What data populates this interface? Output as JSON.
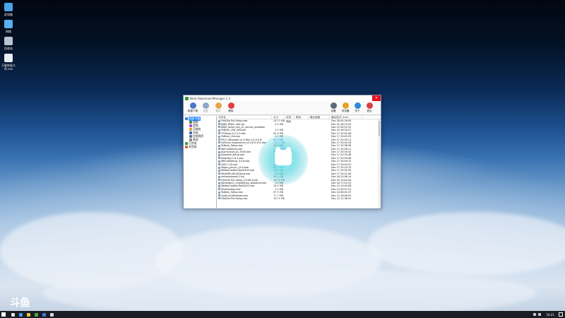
{
  "desktop": {
    "icons": [
      {
        "label": "此电脑",
        "color": "#4aa3e8"
      },
      {
        "label": "网络",
        "color": "#5ab0ee"
      },
      {
        "label": "回收站",
        "color": "#b8c4d0"
      },
      {
        "label": "万能恢复大师.exe",
        "color": "#e8eef4"
      }
    ],
    "logo_text": "斗鱼"
  },
  "window": {
    "title": "Neat Download Manager 1.3",
    "close_glyph": "✕",
    "toolbar": {
      "left": [
        {
          "label": "新建下载",
          "icon": "new-download-icon",
          "color": "#4a78c8",
          "disabled": false
        },
        {
          "label": "恢复",
          "icon": "resume-icon",
          "color": "#8fa7c8",
          "disabled": true
        },
        {
          "label": "暂停",
          "icon": "pause-icon",
          "color": "#e8a64a",
          "disabled": true
        },
        {
          "label": "删除",
          "icon": "delete-icon",
          "color": "#e04040",
          "disabled": false
        }
      ],
      "right": [
        {
          "label": "设置",
          "icon": "settings-icon",
          "color": "#5a6a7a"
        },
        {
          "label": "浏览器",
          "icon": "browser-icon",
          "color": "#e8a02a"
        },
        {
          "label": "关于",
          "icon": "about-icon",
          "color": "#2a8ad8"
        },
        {
          "label": "退出",
          "icon": "exit-icon",
          "color": "#d84040"
        }
      ]
    },
    "tree": [
      {
        "label": "所有下载",
        "indent": 0,
        "selected": true,
        "color": "#3a7ad0"
      },
      {
        "label": "视频",
        "indent": 2,
        "selected": false,
        "color": "#4a8a4a"
      },
      {
        "label": "音频",
        "indent": 2,
        "selected": false,
        "color": "#a84ad0"
      },
      {
        "label": "压缩包",
        "indent": 2,
        "selected": false,
        "color": "#d8a02a"
      },
      {
        "label": "文档",
        "indent": 2,
        "selected": false,
        "color": "#3a6ac0"
      },
      {
        "label": "应用程序",
        "indent": 2,
        "selected": false,
        "color": "#6a7a8a"
      },
      {
        "label": "其他",
        "indent": 2,
        "selected": false,
        "color": "#8a8a8a"
      },
      {
        "label": "已完成",
        "indent": 0,
        "selected": false,
        "color": "#3a9a4a"
      },
      {
        "label": "未完成",
        "indent": 0,
        "selected": false,
        "color": "#d86a2a"
      }
    ],
    "columns": [
      "文件名",
      "大小",
      "状态",
      "剩余",
      "最后速度",
      "最后尝试 (Last"
    ],
    "rows": [
      {
        "name": "FileZilla Pro Setup.exe",
        "size": "107.5 MB",
        "hl": false,
        "status": "完成",
        "date": "Dec 28 00:16:09"
      },
      {
        "name": "NDM_DNS2_x64.zip",
        "size": "4.4 MB",
        "hl": false,
        "status": "",
        "date": "Dec 24 18:15:22"
      },
      {
        "name": "NDM_setup_win_ch_secure_windows",
        "size": "",
        "hl": false,
        "status": "",
        "date": "Dec 22 00:52:31"
      },
      {
        "name": "ToDesk_Lite_x64.exe",
        "size": "3.5 MB",
        "hl": false,
        "status": "",
        "date": "Dec 20 16:32:07"
      },
      {
        "name": "VTSetup-4.2.3-3.exe",
        "size": "60.9 MB",
        "hl": false,
        "status": "",
        "date": "Dec 17 20:42:56"
      },
      {
        "name": "ToDesk_Lite.exe",
        "size": "4.5 MB",
        "hl": false,
        "status": "",
        "date": "Dec 17 20:43:23"
      },
      {
        "name": "PSCC Windows v2.0 Win 2.0.0.0 B",
        "size": "69.9 MB",
        "hl": true,
        "status": "",
        "date": "Dec 17 20:35:11"
      },
      {
        "name": "GeForce_Experience_v3.26.0.131.exe",
        "size": "123.7 MB",
        "hl": true,
        "status": "",
        "date": "Dec 17 20:02:54"
      },
      {
        "name": "ToDesk_Setup.exe",
        "size": "40.2 MB",
        "hl": false,
        "status": "",
        "date": "Dec 17 20:38:36"
      },
      {
        "name": "WeChatSetup.exe",
        "size": "154.5 MB",
        "hl": false,
        "status": "",
        "date": "Dec 17 20:38:11"
      },
      {
        "name": "quarkcloud_pc_5000.exe",
        "size": "82.0 MB",
        "hl": false,
        "status": "",
        "date": "Dec 17 20:35:02"
      },
      {
        "name": "Snipaste_setup.exe",
        "size": "27.2 MB",
        "hl": false,
        "status": "",
        "date": "Dec 17 20:35:46"
      },
      {
        "name": "DownKyi-1.6.1.exe",
        "size": "81.3 MB",
        "hl": false,
        "status": "",
        "date": "Dec 17 20:09:06"
      },
      {
        "name": "WeChatSetup_3.9.8.exe",
        "size": "250.9 MB",
        "hl": false,
        "status": "",
        "date": "Dec 17 20:09:12"
      },
      {
        "name": "QQ9.7.20.exe",
        "size": "158.8 MB",
        "hl": false,
        "status": "",
        "date": "Dec 17 20:04:31"
      },
      {
        "name": "Sogou_pinyin_14.0.exe",
        "size": "66.2 MB",
        "hl": false,
        "status": "",
        "date": "Dec 17 20:14:13"
      },
      {
        "name": "MediaCreationTool22H2.exe",
        "size": "18.5 MB",
        "hl": false,
        "status": "",
        "date": "Dec 17 20:32:53"
      },
      {
        "name": "WinRAR-x64-624scp.exe",
        "size": "3.5 MB",
        "hl": false,
        "status": "",
        "date": "Dec 17 20:22:40"
      },
      {
        "name": "hellowindows11.iso",
        "size": "64.2 GB",
        "hl": false,
        "status": "",
        "date": "Dec 16 22:06:14"
      },
      {
        "name": "FileZilla Pro Setup_V3.66.4.exe",
        "size": "107.5 MB",
        "hl": false,
        "status": "",
        "date": "Dec 16 10:42:04"
      },
      {
        "name": "Windows11_Installation_Assistant.exe",
        "size": "4.0 MB",
        "hl": false,
        "status": "",
        "date": "Dec 16 17:41:51"
      },
      {
        "name": "MediaCreationTool22H2.exe",
        "size": "18.5 MB",
        "hl": false,
        "status": "",
        "date": "Dec 14 10:00:08"
      },
      {
        "name": "Steamsetup.exe",
        "size": "2.3 MB",
        "hl": false,
        "status": "",
        "date": "Dec 14 09:57:01"
      },
      {
        "name": "ToDesk_Setup.exe",
        "size": "87.5 MB",
        "hl": false,
        "status": "",
        "date": "Dec 14 08:42:47"
      },
      {
        "name": "Clash.for.Windows.exe",
        "size": "77.7 MB",
        "hl": false,
        "status": "",
        "date": "Dec 13 16:06:25"
      },
      {
        "name": "FileZilla Pro Setup.exe",
        "size": "107.5 MB",
        "hl": false,
        "status": "",
        "date": "Dec 12 21:36:41"
      }
    ]
  },
  "taskbar": {
    "clock": "16:21",
    "apps": [
      "#dfe6ee",
      "#3aa0e8",
      "#e8c23a",
      "#4aa84a",
      "#3a7ad8",
      "#d8d8d8"
    ]
  }
}
